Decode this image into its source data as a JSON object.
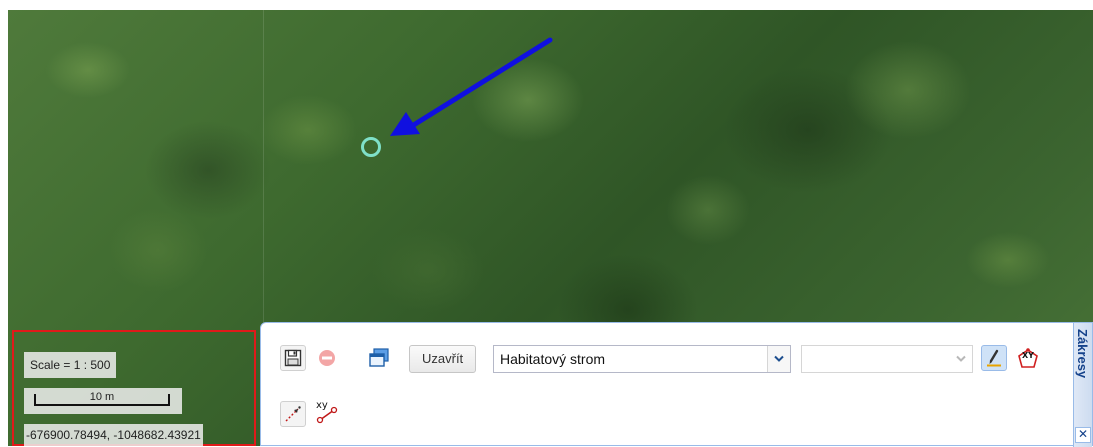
{
  "map": {
    "scale_label": "Scale = 1 : 500",
    "scale_bar_label": "10 m",
    "coordinates": "-676900.78494, -1048682.43921"
  },
  "marker": {
    "shape": "circle",
    "color": "#7fe0c8"
  },
  "arrow": {
    "color": "#1010e0"
  },
  "highlight": {
    "color": "#e01a1a"
  },
  "toolbar": {
    "save_icon": "save-icon",
    "stop_icon": "stop-icon",
    "windows_icon": "windows-icon",
    "close_label": "Uzavřít",
    "habitat_select": {
      "value": "Habitatový strom"
    },
    "second_select": {
      "value": ""
    },
    "edit_icon": "pencil-icon",
    "xy_icon": "xy-point-icon",
    "draw_icon": "draw-line-icon",
    "xy_line_icon": "xy-line-icon",
    "side_tab_label": "Zákresy",
    "side_close": "✕"
  }
}
